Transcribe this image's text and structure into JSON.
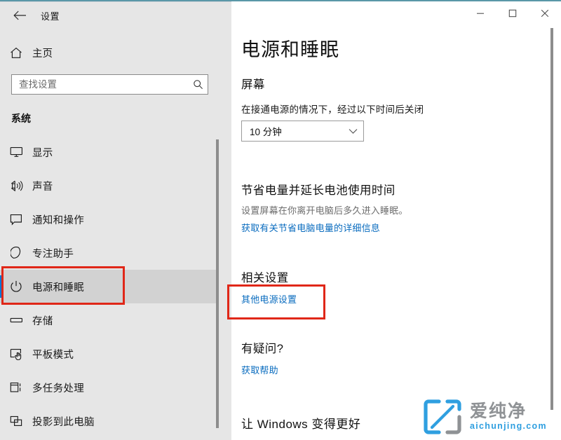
{
  "window": {
    "title": "设置",
    "back_icon": "back-arrow-icon",
    "controls": {
      "minimize": "minimize-icon",
      "maximize": "maximize-icon",
      "close": "close-icon"
    }
  },
  "sidebar": {
    "home": {
      "label": "主页",
      "icon": "home-icon"
    },
    "search": {
      "value": "",
      "placeholder": "查找设置",
      "icon": "search-icon"
    },
    "group_header": "系统",
    "items": [
      {
        "label": "显示",
        "icon": "monitor-icon",
        "selected": false
      },
      {
        "label": "声音",
        "icon": "speaker-icon",
        "selected": false
      },
      {
        "label": "通知和操作",
        "icon": "notification-icon",
        "selected": false
      },
      {
        "label": "专注助手",
        "icon": "moon-icon",
        "selected": false
      },
      {
        "label": "电源和睡眠",
        "icon": "power-icon",
        "selected": true
      },
      {
        "label": "存储",
        "icon": "storage-icon",
        "selected": false
      },
      {
        "label": "平板模式",
        "icon": "tablet-icon",
        "selected": false
      },
      {
        "label": "多任务处理",
        "icon": "multitask-icon",
        "selected": false
      },
      {
        "label": "投影到此电脑",
        "icon": "project-icon",
        "selected": false
      }
    ]
  },
  "main": {
    "page_title": "电源和睡眠",
    "sections": [
      {
        "title": "屏幕",
        "description": "在接通电源的情况下，经过以下时间后关闭",
        "select": {
          "value": "10 分钟",
          "chevron": "chevron-down-icon"
        }
      },
      {
        "title": "节省电量并延长电池使用时间",
        "description": "设置屏幕在你离开电脑后多久进入睡眠。",
        "link": "获取有关节省电脑电量的详细信息"
      },
      {
        "title": "相关设置",
        "link": "其他电源设置"
      },
      {
        "title": "有疑问?",
        "link": "获取帮助"
      }
    ],
    "footer_title": "让 Windows 变得更好"
  },
  "watermark": {
    "cn": "爱纯净",
    "en": "aichunjing.com"
  },
  "colors": {
    "accent": "#0078d7",
    "link": "#0a6cbf",
    "annotation": "#e02718",
    "sidebar_bg": "#e6e6e6",
    "selected_bg": "#d2d2d2",
    "watermark_blue": "#2f9fe0",
    "watermark_gray": "#8f9295",
    "top_rule": "#5a97a8"
  }
}
